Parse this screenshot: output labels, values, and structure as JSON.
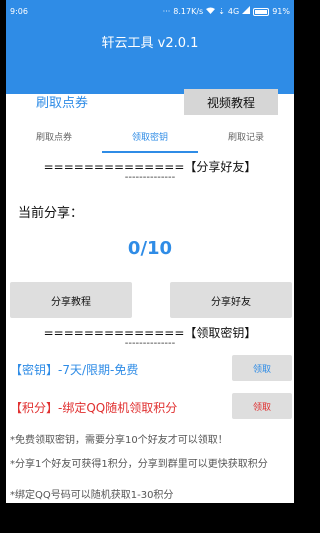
{
  "statusbar": {
    "time": "9:06",
    "network_speed": "8.17K/s",
    "network_type": "4G",
    "battery_percent": "91%",
    "icons": [
      "dots-icon",
      "wifi-icon",
      "signal-icon",
      "battery-icon"
    ]
  },
  "app": {
    "title": "轩云工具 v2.0.1"
  },
  "top": {
    "brush_link": "刷取点券",
    "video_button": "视频教程"
  },
  "tabs": [
    {
      "label": "刷取点券"
    },
    {
      "label": "领取密钥"
    },
    {
      "label": "刷取记录"
    }
  ],
  "share_section": {
    "header": "==============【分享好友】",
    "header_dashes": "--------------",
    "current_share_label": "当前分享：",
    "count": "0/10",
    "tutorial_button": "分享教程",
    "share_button": "分享好友"
  },
  "key_section": {
    "header": "==============【领取密钥】",
    "header_dashes": "--------------",
    "key_row_text": "【密钥】-7天/限期-免费",
    "key_row_button": "领取",
    "points_row_text": "【积分】-绑定QQ随机领取积分",
    "points_row_button": "领取"
  },
  "notes": [
    "*免费领取密钥，需要分享10个好友才可以领取！",
    "*分享1个好友可获得1积分，分享到群里可以更快获取积分",
    "*绑定QQ号码可以随机获取1-30积分"
  ],
  "colors": {
    "primary": "#2f8ce6",
    "danger": "#e03030",
    "button_gray": "#dedede"
  }
}
